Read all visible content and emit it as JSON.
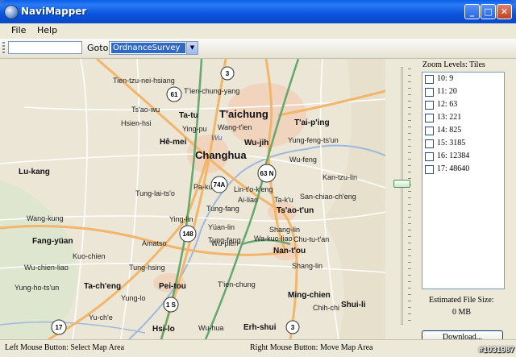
{
  "window": {
    "title": "NaviMapper"
  },
  "menu": {
    "file": "File",
    "help": "Help"
  },
  "toolbar": {
    "address_value": "",
    "goto_label": "Goto",
    "goto_selected": "OrdnanceSurvey"
  },
  "map": {
    "labels": {
      "taichung": "T'aichung",
      "wang_tien": "Wang-t'ien",
      "wu": "Wu",
      "changhua": "Changhua",
      "wu_jih": "Wu-jih",
      "lu_kang": "Lu-kang",
      "taiping": "T'ai-p'ing",
      "tsao_tun": "Ts'ao-t'un",
      "nan_tou": "Nan-t'ou",
      "pei_tou": "Pei-tou",
      "tachang": "Ta-ch'eng",
      "hsi_lo": "Hsi-lo",
      "ming_chien": "Ming-chien",
      "erh_shui": "Erh-shui",
      "shui_li": "Shui-li",
      "fang_yuan": "Fang-yüan",
      "tien_tzu_nei_hsiang": "Tien-tzu-nei-hsiang",
      "tsao_wu": "Ts'ao-wu",
      "hsien_hsi": "Hsien-hsi",
      "hemei": "Hê-mei",
      "ying_pu": "Ying-pu",
      "ta_tu": "Ta-tu",
      "tien_chung_yang": "T'ien-chung-yang",
      "wang_kung": "Wang-kung",
      "tung_lai_ts_o": "Tung-lai-ts'o",
      "yung_feng": "Yung-feng-ts'un",
      "wu_feng": "Wu-feng",
      "kan_tzu_lin": "Kan-tzu-lin",
      "san_chiao": "San-chiao-ch'eng",
      "shang_lin": "Shang-lin",
      "chu_tu": "Chu-tu-t'an",
      "yung_ho": "Yung-ho-ts'un",
      "wu_chien_liao": "Wu-chien-liao",
      "yung_lo": "Yung-lo",
      "tung_hsing": "Tung-hsing",
      "tien_chung": "T'ien-chung",
      "chih_chi": "Chih-chi",
      "tsu_shu": "Yu-ch'e",
      "wu_hua": "Wu-hua",
      "yun_lin": "Ying-lin",
      "pa_kua": "Pa-kua",
      "kuo_chien": "Kuo-chien",
      "tung_fang": "Tung-fang",
      "tung_fang2": "Tung-fang",
      "yuan_lin": "Yüan-lin",
      "amatso": "Amatso",
      "wu_pien": "Wu-pien",
      "lin_tu": "Lin-t'o-k'eng",
      "ai_liao": "Ai-liao",
      "ta_k_u": "Ta-k'u",
      "wa_kuo": "Wa-kuo-liao",
      "shang_lin2": "Shang-lin"
    },
    "shields": {
      "s3a": "3",
      "s61": "61",
      "s63n": "63 N",
      "s74a": "74A",
      "s148": "148",
      "s1s": "1 S",
      "s17": "17",
      "s3b": "3"
    }
  },
  "slider": {
    "value": "10"
  },
  "zoom": {
    "title": "Zoom Levels: Tiles",
    "levels": [
      {
        "label": "10: 9",
        "checked": false
      },
      {
        "label": "11: 20",
        "checked": false
      },
      {
        "label": "12: 63",
        "checked": false
      },
      {
        "label": "13: 221",
        "checked": false
      },
      {
        "label": "14: 825",
        "checked": false
      },
      {
        "label": "15: 3185",
        "checked": false
      },
      {
        "label": "16: 12384",
        "checked": false
      },
      {
        "label": "17: 48640",
        "checked": false
      }
    ]
  },
  "estimate": {
    "label": "Estimated File Size:",
    "value": "0 MB"
  },
  "download": {
    "label": "Download..."
  },
  "status": {
    "left": "Left Mouse Button: Select Map Area",
    "right": "Right Mouse Button: Move Map Area"
  },
  "watermark": "#1031987",
  "colors": {
    "titlebar": "#0a5ee8",
    "highway": "#f2b870",
    "motorway": "#5aa36a",
    "water": "#a9c4e6",
    "urban": "#f2dcc6"
  }
}
